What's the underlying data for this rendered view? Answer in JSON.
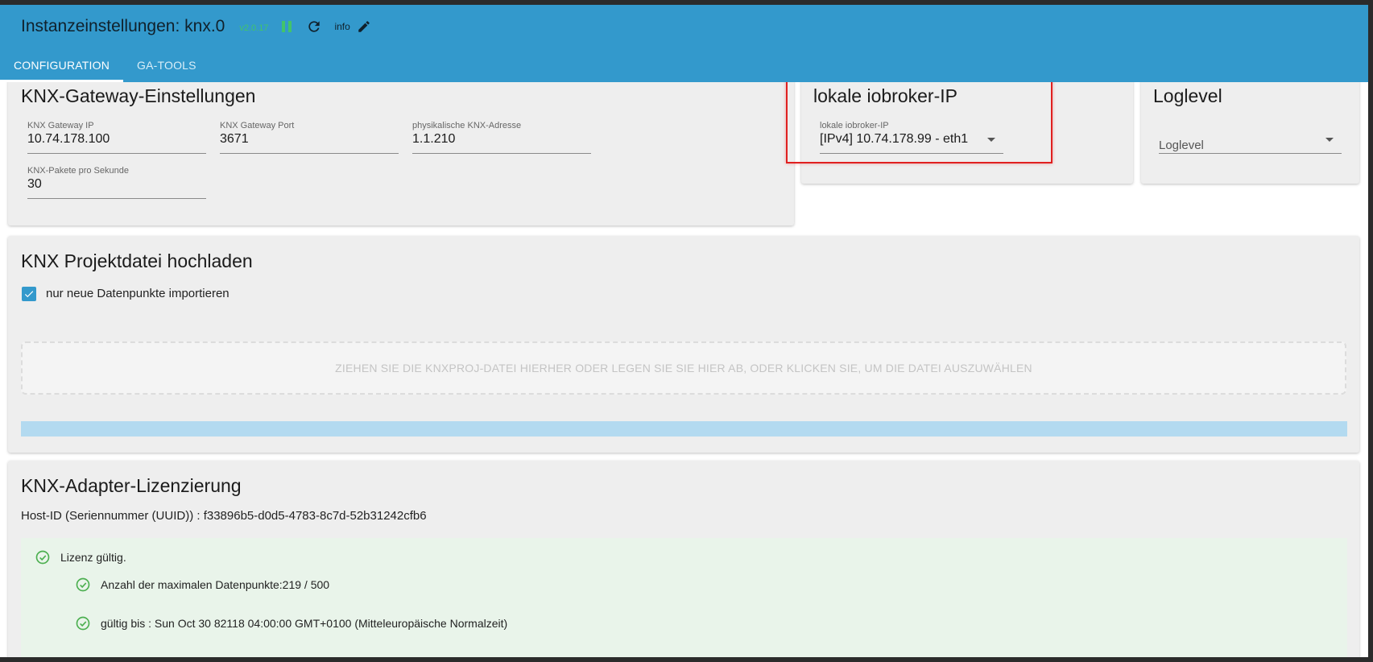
{
  "header": {
    "title": "Instanzeinstellungen: knx.0",
    "version": "v2.0.17",
    "info_label": "info",
    "icons": [
      "pause-icon",
      "refresh-icon",
      "pencil-icon"
    ]
  },
  "tabs": [
    {
      "label": "CONFIGURATION",
      "active": true
    },
    {
      "label": "GA-TOOLS",
      "active": false
    }
  ],
  "gateway": {
    "title": "KNX-Gateway-Einstellungen",
    "fields": [
      {
        "label": "KNX Gateway IP",
        "value": "10.74.178.100"
      },
      {
        "label": "KNX Gateway Port",
        "value": "3671"
      },
      {
        "label": "physikalische KNX-Adresse",
        "value": "1.1.210"
      },
      {
        "label": "KNX-Pakete pro Sekunde",
        "value": "30"
      }
    ]
  },
  "local_ip": {
    "title": "lokale iobroker-IP",
    "label": "lokale iobroker-IP",
    "value": "[IPv4] 10.74.178.99 - eth1"
  },
  "loglevel": {
    "title": "Loglevel",
    "placeholder": "Loglevel"
  },
  "project": {
    "title": "KNX Projektdatei hochladen",
    "checkbox_label": "nur neue Datenpunkte importieren",
    "checkbox_checked": true,
    "dropzone_text": "ZIEHEN SIE DIE KNXPROJ-DATEI HIERHER ODER LEGEN SIE SIE HIER AB, ODER KLICKEN SIE, UM DIE DATEI AUSZUWÄHLEN"
  },
  "license": {
    "title": "KNX-Adapter-Lizenzierung",
    "host_id": "Host-ID (Seriennummer (UUID)) : f33896b5-d0d5-4783-8c7d-52b31242cfb6",
    "items": [
      {
        "text": "Lizenz gültig."
      },
      {
        "text": "Anzahl der maximalen Datenpunkte:219 / 500"
      },
      {
        "text": "gültig bis : Sun Oct 30 82118 04:00:00 GMT+0100 (Mitteleuropäische Normalzeit)"
      }
    ]
  },
  "colors": {
    "accent": "#3399cc",
    "version": "#42c46b",
    "highlight": "#e02020",
    "success": "#4caf50",
    "license_bg": "#e9f4ea"
  }
}
